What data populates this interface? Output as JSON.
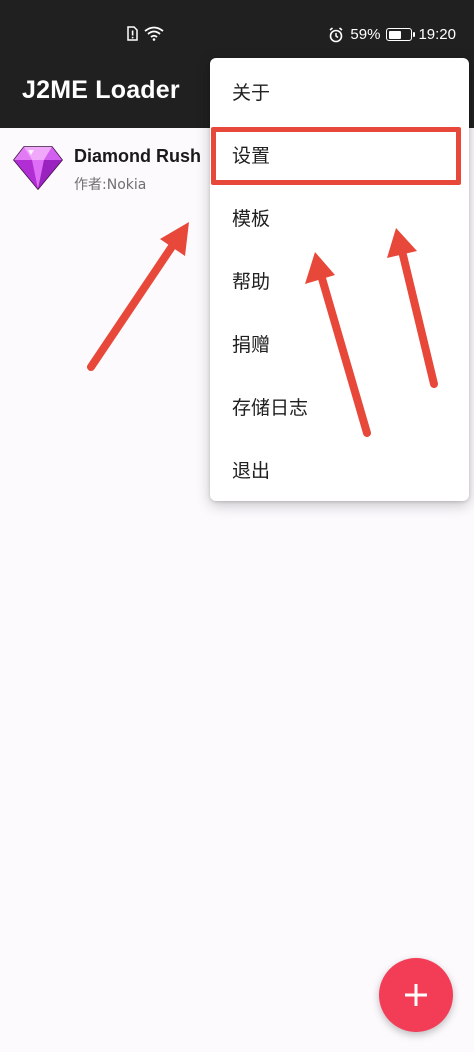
{
  "status_bar": {
    "battery": "59%",
    "battery_level": 0.59,
    "time": "19:20",
    "icons": [
      "sim-alert-icon",
      "wifi-icon",
      "alarm-icon",
      "battery-icon"
    ]
  },
  "app_bar": {
    "title": "J2ME Loader"
  },
  "apps": [
    {
      "name": "Diamond Rush",
      "subtitle": "作者:Nokia",
      "icon": "diamond-icon"
    }
  ],
  "menu": {
    "items": [
      "关于",
      "设置",
      "模板",
      "帮助",
      "捐赠",
      "存储日志",
      "退出"
    ],
    "highlighted_index": 1
  },
  "fab": {
    "label": "+",
    "icon": "plus-icon"
  },
  "colors": {
    "app_bar": "#202020",
    "accent": "#f33c56",
    "annotation": "#e8483a",
    "diamond": "#c43ee6"
  }
}
